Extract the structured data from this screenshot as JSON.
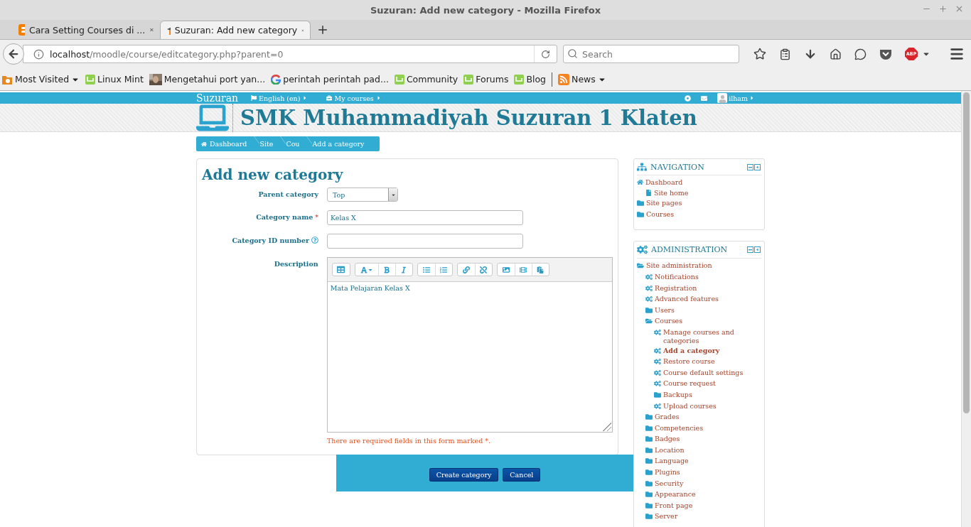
{
  "window": {
    "title": "Suzuran: Add new category - Mozilla Firefox"
  },
  "tabs": [
    {
      "label": "Cara Setting Courses di ...",
      "selected": false
    },
    {
      "label": "Suzuran: Add new category",
      "selected": true
    }
  ],
  "address_bar": {
    "host": "localhost",
    "path": "/moodle/course/editcategory.php?parent=0"
  },
  "search": {
    "placeholder": "Search"
  },
  "toolbar": {
    "adblock_badge": "ABP"
  },
  "bookmarks": [
    {
      "label": "Most Visited",
      "kind": "folder",
      "menu": true
    },
    {
      "label": "Linux Mint",
      "kind": "mint",
      "menu": false
    },
    {
      "label": "Mengetahui port yan...",
      "menu": false
    },
    {
      "label": "perintah perintah pad...",
      "kind": "google",
      "menu": false
    },
    {
      "label": "Community",
      "kind": "mint",
      "menu": false
    },
    {
      "label": "Forums",
      "kind": "mint",
      "menu": false
    },
    {
      "label": "Blog",
      "kind": "mint",
      "menu": false
    },
    {
      "label": "News",
      "kind": "feed",
      "menu": true
    }
  ],
  "site": {
    "brand": "Suzuran",
    "menus": [
      {
        "label": "English (en)"
      },
      {
        "label": "My courses"
      }
    ],
    "user": "ilham",
    "title": "SMK Muhammadiyah Suzuran 1 Klaten"
  },
  "breadcrumb": [
    {
      "label": "Dashboard"
    },
    {
      "label": "Site"
    },
    {
      "label": "Cou"
    },
    {
      "label": "Add a category"
    }
  ],
  "form": {
    "heading": "Add new category",
    "fields": [
      {
        "kind": "select",
        "label": "Parent category",
        "value": "Top",
        "help": false
      },
      {
        "kind": "text",
        "label": "Category name",
        "value": "Kelas X",
        "marker": "*",
        "help": false
      },
      {
        "kind": "text",
        "label": "Category ID number",
        "help": true
      },
      {
        "kind": "editor",
        "label": "Description",
        "value": "Mata Pelajaran Kelas X",
        "help": false
      }
    ],
    "required_note": "There are required fields in this form marked *.",
    "buttons": [
      {
        "label": "Create category"
      },
      {
        "label": "Cancel"
      }
    ]
  },
  "blocks": [
    {
      "title": "NAVIGATION",
      "items": [
        {
          "label": "Dashboard",
          "kind": "home",
          "selected": false,
          "children": [
            {
              "label": "Site home",
              "kind": "page",
              "selected": false
            }
          ]
        },
        {
          "label": "Site pages",
          "kind": "folder",
          "selected": false
        },
        {
          "label": "Courses",
          "kind": "folder",
          "selected": false
        }
      ]
    },
    {
      "title": "ADMINISTRATION",
      "items": [
        {
          "label": "Site administration",
          "kind": "folder-open",
          "selected": false,
          "children": [
            {
              "label": "Notifications",
              "kind": "gear",
              "selected": false
            },
            {
              "label": "Registration",
              "kind": "gear",
              "selected": false
            },
            {
              "label": "Advanced features",
              "kind": "gear",
              "selected": false
            },
            {
              "label": "Users",
              "kind": "folder",
              "selected": false
            },
            {
              "label": "Courses",
              "kind": "folder-open",
              "selected": false,
              "children": [
                {
                  "label": "Manage courses and categories",
                  "kind": "gear",
                  "selected": false
                },
                {
                  "label": "Add a category",
                  "kind": "gear",
                  "selected": true
                },
                {
                  "label": "Restore course",
                  "kind": "gear",
                  "selected": false
                },
                {
                  "label": "Course default settings",
                  "kind": "gear",
                  "selected": false
                },
                {
                  "label": "Course request",
                  "kind": "gear",
                  "selected": false
                },
                {
                  "label": "Backups",
                  "kind": "folder",
                  "selected": false
                },
                {
                  "label": "Upload courses",
                  "kind": "gear",
                  "selected": false
                }
              ]
            },
            {
              "label": "Grades",
              "kind": "folder",
              "selected": false
            },
            {
              "label": "Competencies",
              "kind": "folder",
              "selected": false
            },
            {
              "label": "Badges",
              "kind": "folder",
              "selected": false
            },
            {
              "label": "Location",
              "kind": "folder",
              "selected": false
            },
            {
              "label": "Language",
              "kind": "folder",
              "selected": false
            },
            {
              "label": "Plugins",
              "kind": "folder",
              "selected": false
            },
            {
              "label": "Security",
              "kind": "folder",
              "selected": false
            },
            {
              "label": "Appearance",
              "kind": "folder",
              "selected": false
            },
            {
              "label": "Front page",
              "kind": "folder",
              "selected": false
            },
            {
              "label": "Server",
              "kind": "folder",
              "selected": false
            }
          ]
        }
      ]
    }
  ]
}
